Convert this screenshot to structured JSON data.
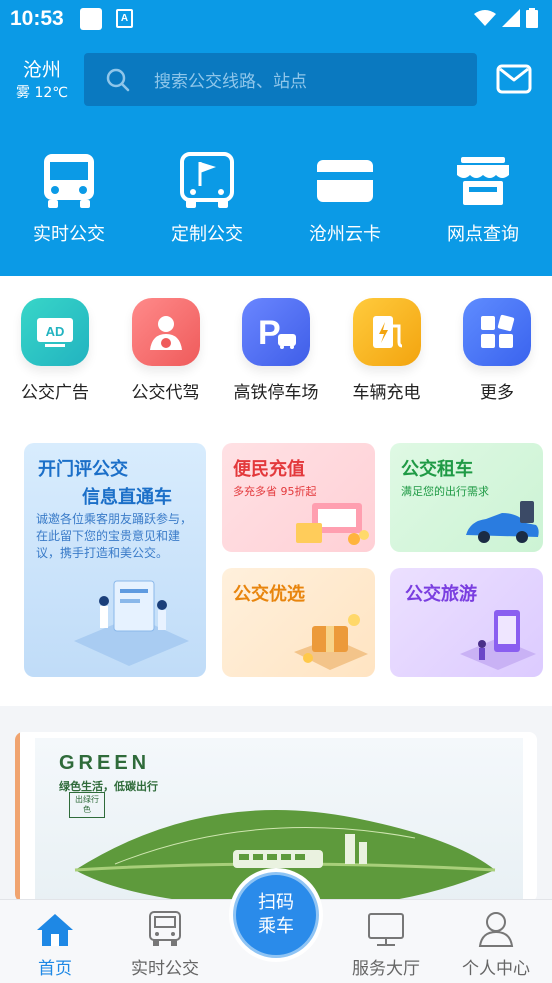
{
  "status_bar": {
    "time": "10:53",
    "app_icon_letter": "A"
  },
  "location": {
    "city": "沧州",
    "weather": "雾 12℃"
  },
  "search": {
    "placeholder": "搜索公交线路、站点"
  },
  "main_nav": [
    {
      "label": "实时公交",
      "icon": "bus-icon"
    },
    {
      "label": "定制公交",
      "icon": "bus-flag-icon"
    },
    {
      "label": "沧州云卡",
      "icon": "card-icon"
    },
    {
      "label": "网点查询",
      "icon": "store-icon"
    }
  ],
  "services": [
    {
      "label": "公交广告",
      "icon": "ad-icon",
      "badge": "AD",
      "color": "#2cc6c0"
    },
    {
      "label": "公交代驾",
      "icon": "driver-icon",
      "color": "#f26a6a"
    },
    {
      "label": "高铁停车场",
      "icon": "parking-icon",
      "badge": "P",
      "color": "#4b6cf0"
    },
    {
      "label": "车辆充电",
      "icon": "charging-icon",
      "color": "#f5b21a"
    },
    {
      "label": "更多",
      "icon": "more-icon",
      "color": "#3f70f0"
    }
  ],
  "cards": {
    "review": {
      "title1": "开门评公交",
      "title2": "信息直通车",
      "body": "诚邀各位乘客朋友踊跃参与，在此留下您的宝贵意见和建议，携手打造和美公交。"
    },
    "recharge": {
      "title": "便民充值",
      "subtitle": "多充多省 95折起"
    },
    "rental": {
      "title": "公交租车",
      "subtitle": "满足您的出行需求"
    },
    "select": {
      "title": "公交优选"
    },
    "travel": {
      "title": "公交旅游"
    }
  },
  "banner": {
    "headline": "GREEN",
    "slogan": "绿色生活，低碳出行",
    "stamp": "出绿行色"
  },
  "tabbar": {
    "home": "首页",
    "realtime": "实时公交",
    "scan_line1": "扫码",
    "scan_line2": "乘车",
    "service": "服务大厅",
    "profile": "个人中心"
  },
  "colors": {
    "primary": "#0b9ae6",
    "tab_active": "#1e88e5"
  }
}
